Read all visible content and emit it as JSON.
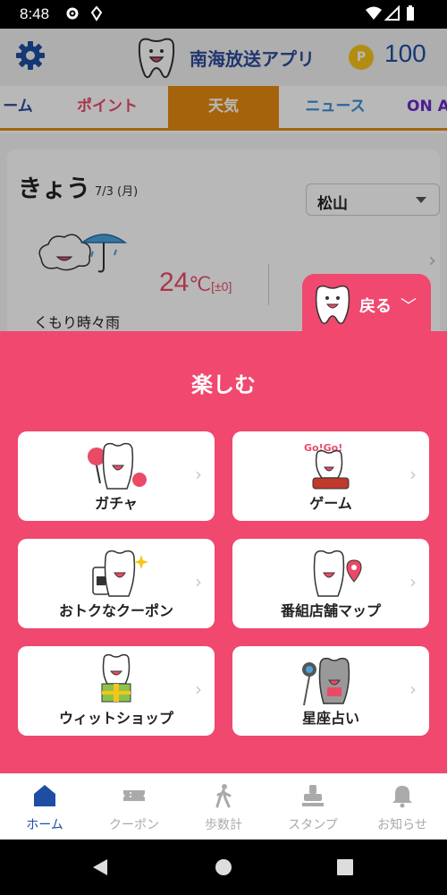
{
  "status_bar": {
    "time": "8:48"
  },
  "header": {
    "app_title": "南海放送アプリ",
    "coin_letter": "P",
    "points": "100"
  },
  "tabs": [
    {
      "label": "ーム"
    },
    {
      "label": "ポイント"
    },
    {
      "label": "天気"
    },
    {
      "label": "ニュース"
    },
    {
      "label": "ON A"
    }
  ],
  "weather": {
    "today_label": "きょう",
    "date": "7/3 (月)",
    "location": "松山",
    "temperature": "24",
    "temp_unit": "℃",
    "temp_diff": "[±0]",
    "description": "くもり時々雨"
  },
  "back_button": {
    "label": "戻る"
  },
  "enjoy": {
    "title": "楽しむ",
    "items": [
      {
        "label": "ガチャ"
      },
      {
        "label": "ゲーム"
      },
      {
        "label": "おトクなクーポン"
      },
      {
        "label": "番組店舗マップ"
      },
      {
        "label": "ウィットショップ"
      },
      {
        "label": "星座占い"
      }
    ]
  },
  "bottom_nav": [
    {
      "label": "ホーム"
    },
    {
      "label": "クーポン"
    },
    {
      "label": "歩数計"
    },
    {
      "label": "スタンプ"
    },
    {
      "label": "お知らせ"
    }
  ],
  "colors": {
    "accent_pink": "#f0486e",
    "brand_blue": "#1e4ea3",
    "tab_orange": "#e58b11"
  }
}
